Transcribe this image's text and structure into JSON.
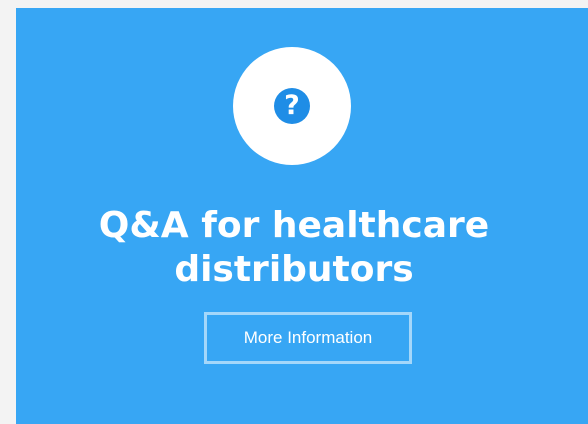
{
  "card": {
    "title_line1": "Q&A for healthcare",
    "title_line2": "distributors",
    "button_label": "More Information",
    "icon": "question-mark-icon",
    "icon_glyph": "?"
  },
  "colors": {
    "page_background": "#f3f3f3",
    "card_background": "#37a6f4",
    "icon_circle": "#ffffff",
    "icon_fill": "#1f8de6",
    "text": "#ffffff"
  }
}
